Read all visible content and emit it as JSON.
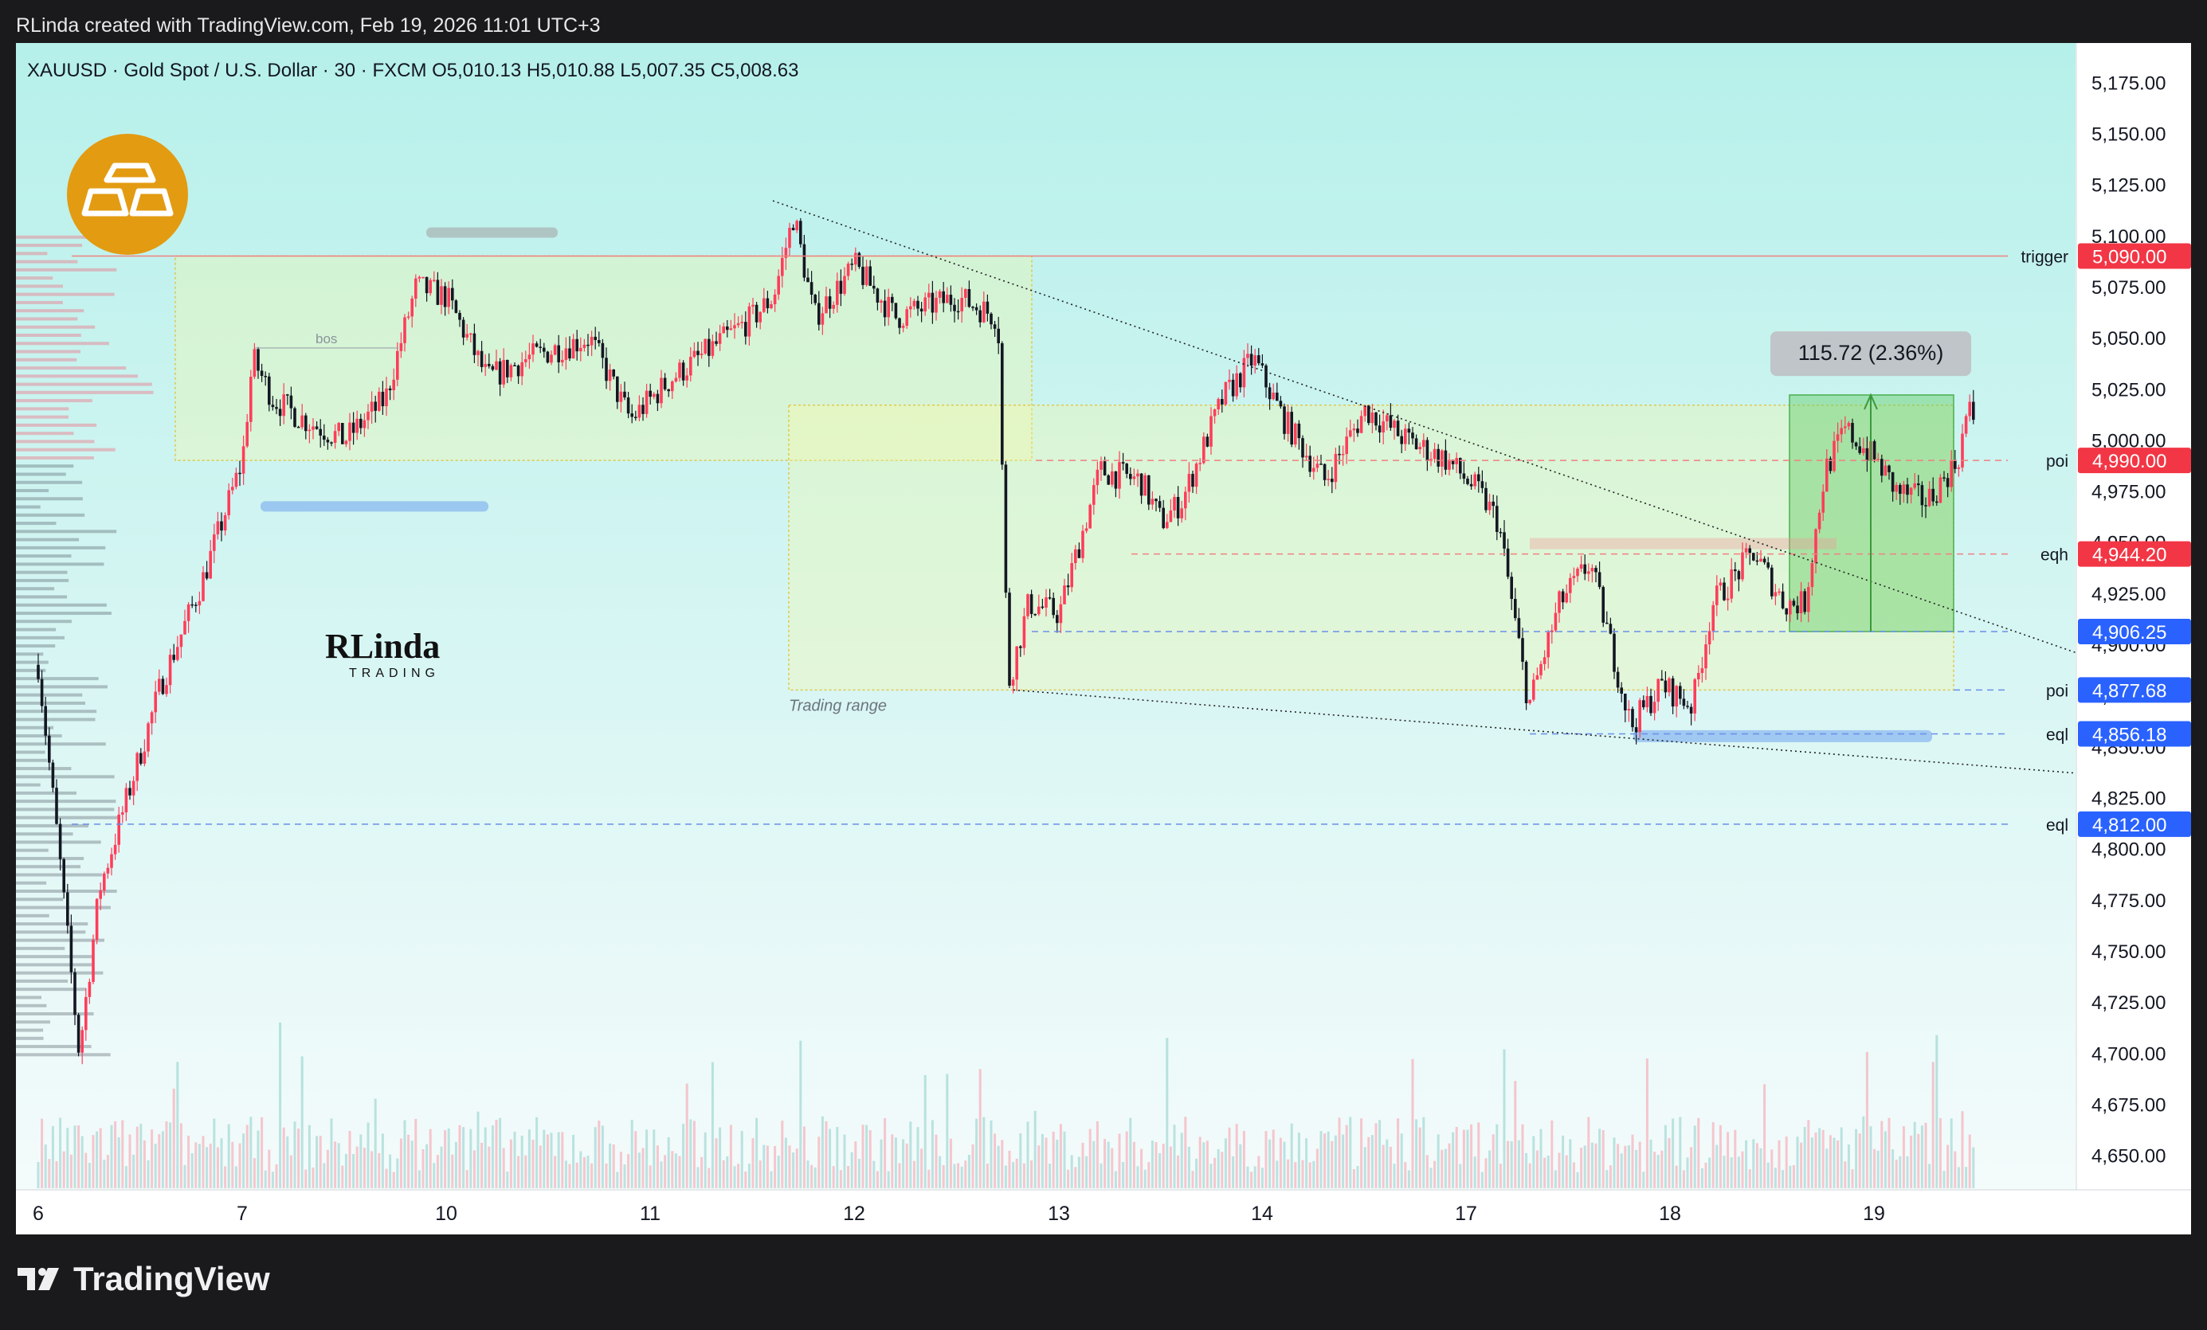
{
  "header": {
    "created_by": "RLinda created with TradingView.com, Feb 19, 2026 11:01 UTC+3"
  },
  "symbol": {
    "ticker": "XAUUSD",
    "name": "Gold Spot / U.S. Dollar",
    "interval": "30",
    "exchange": "FXCM",
    "ohlc_text": "XAUUSD · Gold Spot / U.S. Dollar · 30 · FXCM  O5,010.13  H5,010.88  L5,007.35  C5,008.63"
  },
  "brand": {
    "footer": "TradingView",
    "watermark_top": "RLinda",
    "watermark_bottom": "TRADING"
  },
  "colors": {
    "bg_top": "#b6f0ea",
    "bg_bottom": "#f4fbfb",
    "up": "#ff3d5a",
    "down": "#131722",
    "red_tag": "#f23645",
    "blue_tag": "#2962ff",
    "green_box": "#66cc66",
    "gold_icon": "#e39b12"
  },
  "chart_data": {
    "type": "candlestick",
    "y_axis": {
      "ticks": [
        "5,175.00",
        "5,150.00",
        "5,125.00",
        "5,100.00",
        "5,075.00",
        "5,050.00",
        "5,025.00",
        "5,000.00",
        "4,975.00",
        "4,950.00",
        "4,925.00",
        "4,900.00",
        "4,875.00",
        "4,850.00",
        "4,825.00",
        "4,800.00",
        "4,775.00",
        "4,750.00",
        "4,725.00",
        "4,700.00",
        "4,675.00",
        "4,650.00"
      ],
      "range": [
        4640,
        5185
      ]
    },
    "x_axis": {
      "ticks": [
        "6",
        "7",
        "10",
        "11",
        "12",
        "13",
        "14",
        "17",
        "18",
        "19"
      ]
    },
    "price_path": [
      [
        0,
        4890
      ],
      [
        0.1,
        4800
      ],
      [
        0.2,
        4700
      ],
      [
        0.3,
        4780
      ],
      [
        0.45,
        4830
      ],
      [
        0.6,
        4880
      ],
      [
        0.8,
        4930
      ],
      [
        1.0,
        4990
      ],
      [
        1.05,
        5040
      ],
      [
        1.15,
        5020
      ],
      [
        1.3,
        5010
      ],
      [
        1.5,
        5000
      ],
      [
        1.7,
        5020
      ],
      [
        1.85,
        5075
      ],
      [
        2.0,
        5070
      ],
      [
        2.2,
        5030
      ],
      [
        2.4,
        5040
      ],
      [
        2.7,
        5050
      ],
      [
        2.9,
        5010
      ],
      [
        3.1,
        5030
      ],
      [
        3.3,
        5045
      ],
      [
        3.5,
        5060
      ],
      [
        3.6,
        5070
      ],
      [
        3.7,
        5110
      ],
      [
        3.8,
        5060
      ],
      [
        4.0,
        5085
      ],
      [
        4.2,
        5060
      ],
      [
        4.5,
        5070
      ],
      [
        4.7,
        5060
      ],
      [
        4.75,
        4880
      ],
      [
        4.85,
        4920
      ],
      [
        5.0,
        4915
      ],
      [
        5.2,
        4985
      ],
      [
        5.4,
        4980
      ],
      [
        5.5,
        4960
      ],
      [
        5.6,
        4970
      ],
      [
        5.8,
        5020
      ],
      [
        5.95,
        5040
      ],
      [
        6.1,
        5010
      ],
      [
        6.3,
        4980
      ],
      [
        6.5,
        5015
      ],
      [
        6.7,
        5000
      ],
      [
        6.9,
        4990
      ],
      [
        7.05,
        4975
      ],
      [
        7.15,
        4960
      ],
      [
        7.3,
        4870
      ],
      [
        7.45,
        4920
      ],
      [
        7.6,
        4940
      ],
      [
        7.7,
        4900
      ],
      [
        7.8,
        4860
      ],
      [
        7.95,
        4880
      ],
      [
        8.1,
        4870
      ],
      [
        8.2,
        4920
      ],
      [
        8.4,
        4945
      ],
      [
        8.55,
        4920
      ],
      [
        8.65,
        4920
      ],
      [
        8.75,
        4985
      ],
      [
        8.85,
        5005
      ],
      [
        9.0,
        4990
      ],
      [
        9.1,
        4975
      ],
      [
        9.25,
        4970
      ],
      [
        9.4,
        4990
      ],
      [
        9.45,
        5015
      ],
      [
        9.5,
        5008
      ]
    ],
    "annotations": {
      "trigger": {
        "label": "trigger",
        "price_label": "5,090.00"
      },
      "poi_upper": {
        "label": "poi",
        "price_label": "4,990.00"
      },
      "eqh": {
        "label": "eqh",
        "price_label": "4,944.20"
      },
      "level_mid": {
        "price_label": "4,906.25"
      },
      "poi_lower": {
        "label": "poi",
        "price_label": "4,877.68"
      },
      "eql_upper": {
        "label": "eql",
        "price_label": "4,856.18"
      },
      "eql_lower": {
        "label": "eql",
        "price_label": "4,812.00"
      },
      "bos": {
        "label": "bos"
      },
      "trading_range": {
        "label": "Trading range"
      },
      "measure": {
        "label": "115.72 (2.36%)"
      }
    }
  }
}
